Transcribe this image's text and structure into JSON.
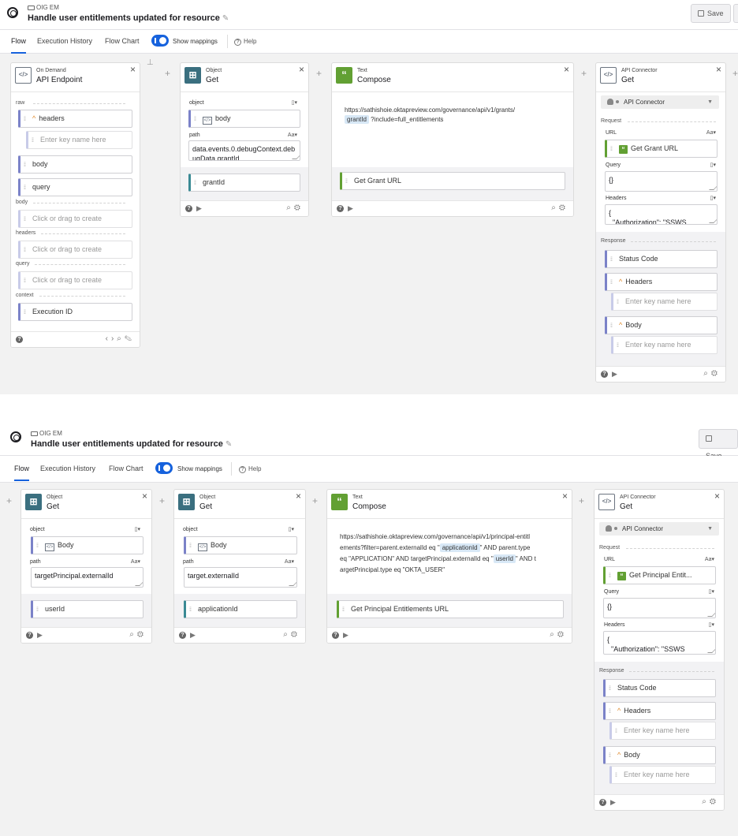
{
  "header": {
    "breadcrumb": "OIG EM",
    "title": "Handle user entitlements updated for resource",
    "save_label": "Save"
  },
  "tabs": [
    {
      "label": "Flow"
    },
    {
      "label": "Execution History"
    },
    {
      "label": "Flow Chart"
    }
  ],
  "mappings_toggle": {
    "label": "Show mappings",
    "on": true
  },
  "help_label": "Help",
  "colors": {
    "accent": "#1662dd",
    "object_icon": "#3a6f7f",
    "text_icon": "#62a033",
    "mapping_bar": "#7b82c8"
  },
  "flow1": {
    "endpoint": {
      "category": "On Demand",
      "name": "API Endpoint",
      "sections": {
        "raw": "raw",
        "body": "body",
        "headers": "headers",
        "query": "query",
        "context": "context"
      },
      "raw_headers": "headers",
      "key_placeholder": "Enter key name here",
      "raw_body": "body",
      "raw_query": "query",
      "create_placeholder": "Click or drag to create",
      "execution_id": "Execution ID"
    },
    "object_get": {
      "category": "Object",
      "name": "Get",
      "object_label": "object",
      "object_value": "body",
      "path_label": "path",
      "path_type": "Aa",
      "path_value": "data.events.0.debugContext.debugData.grantId",
      "output": "grantId"
    },
    "compose": {
      "category": "Text",
      "name": "Compose",
      "text_before": "https://sathishoie.oktapreview.com/governance/api/v1/grants/",
      "token": "grantId",
      "text_after": "?include=full_entitlements",
      "output": "Get Grant URL"
    },
    "api_connector": {
      "category": "API Connector",
      "name": "Get",
      "connection": "API Connector",
      "request_label": "Request",
      "url_label": "URL",
      "url_type": "Aa",
      "url_value": "Get Grant URL",
      "query_label": "Query",
      "query_value": "{}",
      "headers_label": "Headers",
      "headers_value": "{\n  \"Authorization\": \"SSWS",
      "response_label": "Response",
      "status_code": "Status Code",
      "resp_headers": "Headers",
      "resp_body": "Body",
      "key_placeholder": "Enter key name here"
    }
  },
  "flow2": {
    "object_get_1": {
      "category": "Object",
      "name": "Get",
      "object_label": "object",
      "object_value": "Body",
      "path_label": "path",
      "path_type": "Aa",
      "path_value": "targetPrincipal.externalId",
      "output": "userId"
    },
    "object_get_2": {
      "category": "Object",
      "name": "Get",
      "object_label": "object",
      "object_value": "Body",
      "path_label": "path",
      "path_type": "Aa",
      "path_value": "target.externalId",
      "output": "applicationId"
    },
    "compose": {
      "category": "Text",
      "name": "Compose",
      "line1": "https://sathishoie.oktapreview.com/governance/api/v1/principal-entitl",
      "line2a": "ements?filter=parent.externalId eq \"",
      "token1": "applicationId",
      "line2b": "\" AND parent.type",
      "line3a": "eq \"APPLICATION\" AND targetPrincipal.externalId eq \"",
      "token2": "userId",
      "line3b": "\" AND t",
      "line4": "argetPrincipal.type eq \"OKTA_USER\"",
      "output": "Get Principal Entitlements URL"
    },
    "api_connector": {
      "category": "API Connector",
      "name": "Get",
      "connection": "API Connector",
      "request_label": "Request",
      "url_label": "URL",
      "url_type": "Aa",
      "url_value": "Get Principal Entit...",
      "query_label": "Query",
      "query_value": "{}",
      "headers_label": "Headers",
      "headers_value": "{\n  \"Authorization\": \"SSWS",
      "response_label": "Response",
      "status_code": "Status Code",
      "resp_headers": "Headers",
      "resp_body": "Body",
      "key_placeholder": "Enter key name here"
    }
  }
}
